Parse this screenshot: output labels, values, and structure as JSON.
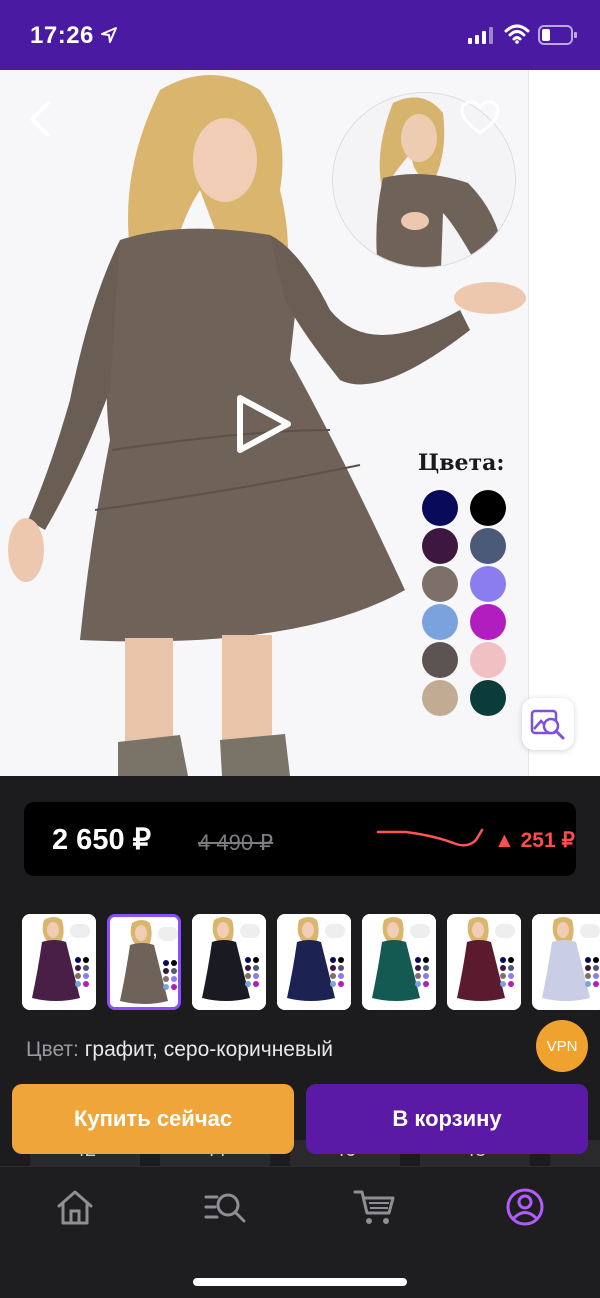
{
  "status_bar": {
    "time": "17:26",
    "icons": [
      "location-arrow-icon",
      "signal-icon",
      "wifi-icon",
      "battery-icon"
    ],
    "background": "#4a1aa3"
  },
  "product_image": {
    "colors_title": "Цвета:",
    "swatches": [
      "#0a0a5a",
      "#000000",
      "#3e1740",
      "#4a5a78",
      "#7d6f6a",
      "#8b7cf0",
      "#7aa3de",
      "#b21dbf",
      "#5b5452",
      "#f1c0c3",
      "#c2ab93",
      "#0c3c3a"
    ],
    "icons": {
      "back": "chevron-left-icon",
      "favorite": "heart-icon",
      "share": "share-icon",
      "play": "play-icon",
      "image_search": "image-search-icon"
    }
  },
  "price": {
    "current": "2 650 ₽",
    "old": "4 490 ₽",
    "delta": "▲ 251 ₽",
    "delta_color": "#ff4d4d"
  },
  "thumbnails": [
    {
      "dress_color": "#4a1f47",
      "selected": false
    },
    {
      "dress_color": "#6f6258",
      "selected": true
    },
    {
      "dress_color": "#1a1a22",
      "selected": false
    },
    {
      "dress_color": "#1c2352",
      "selected": false
    },
    {
      "dress_color": "#145a52",
      "selected": false
    },
    {
      "dress_color": "#5b1a2e",
      "selected": false
    },
    {
      "dress_color": "#c9cde6",
      "selected": false
    }
  ],
  "color_info": {
    "label": "Цвет:",
    "value": "графит, серо-коричневый"
  },
  "vpn_badge": "VPN",
  "sizes_partial": [
    "42",
    "44",
    "46",
    "48",
    "5"
  ],
  "actions": {
    "buy_now": "Купить сейчас",
    "add_to_cart": "В корзину",
    "buy_color": "#f0a53a",
    "cart_color": "#5a1aa5"
  },
  "tab_bar": {
    "tabs": [
      {
        "icon": "home-icon",
        "active": false
      },
      {
        "icon": "search-list-icon",
        "active": false
      },
      {
        "icon": "cart-icon",
        "active": false
      },
      {
        "icon": "profile-icon",
        "active": true
      }
    ],
    "active_color": "#b05cff"
  }
}
